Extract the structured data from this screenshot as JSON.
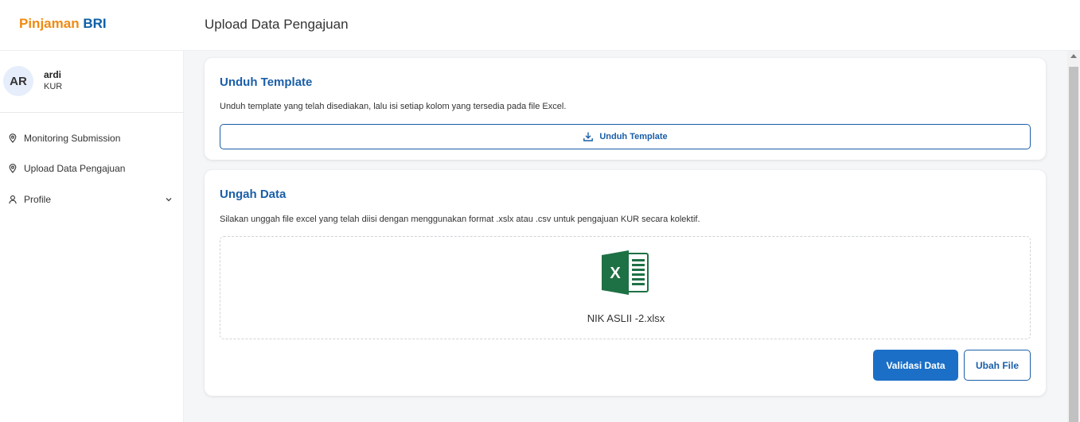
{
  "brand": {
    "part1": "Pinjaman",
    "part2": "BRI"
  },
  "header": {
    "title": "Upload Data Pengajuan"
  },
  "user": {
    "initials": "AR",
    "name": "ardi",
    "role": "KUR"
  },
  "sidebar": {
    "items": [
      {
        "label": "Monitoring Submission",
        "icon": "location-pin-icon"
      },
      {
        "label": "Upload Data Pengajuan",
        "icon": "location-pin-icon"
      },
      {
        "label": "Profile",
        "icon": "person-icon",
        "expandable": true
      }
    ]
  },
  "template_card": {
    "title": "Unduh Template",
    "description": "Unduh template yang telah disediakan, lalu isi setiap kolom yang tersedia pada file Excel.",
    "button_label": "Unduh Template",
    "button_icon": "download-icon"
  },
  "upload_card": {
    "title": "Ungah Data",
    "description": "Silakan unggah file excel yang telah diisi dengan menggunakan format .xslx atau .csv untuk pengajuan KUR secara kolektif.",
    "file_icon": "excel-file-icon",
    "file_name": "NIK ASLII -2.xlsx",
    "validate_label": "Validasi Data",
    "change_label": "Ubah File"
  },
  "colors": {
    "brand_orange": "#f08a12",
    "brand_blue": "#0c5fa8",
    "primary": "#1b6fc6",
    "excel_green": "#1e7145"
  }
}
